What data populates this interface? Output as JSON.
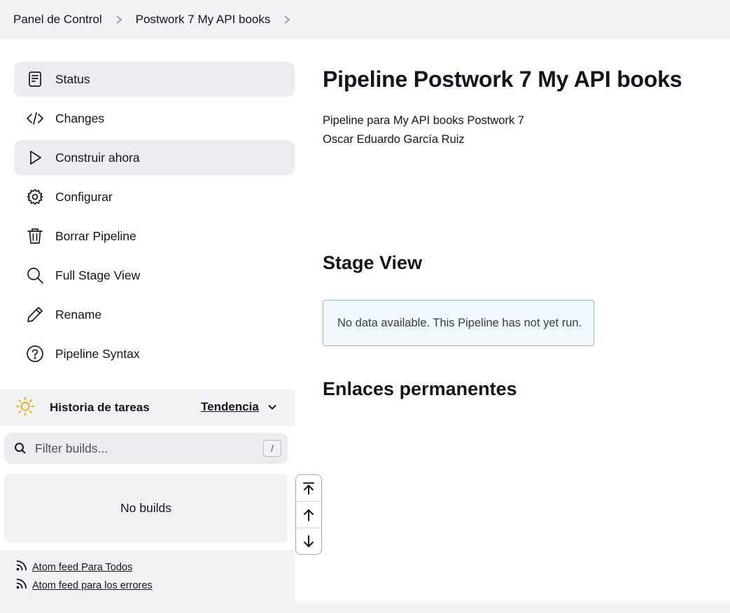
{
  "breadcrumb": {
    "items": [
      "Panel de Control",
      "Postwork 7 My API books"
    ]
  },
  "sidebar": {
    "items": [
      {
        "label": "Status",
        "icon": "document-icon",
        "highlighted": true
      },
      {
        "label": "Changes",
        "icon": "code-icon",
        "highlighted": false
      },
      {
        "label": "Construir ahora",
        "icon": "play-icon",
        "highlighted": true
      },
      {
        "label": "Configurar",
        "icon": "gear-icon",
        "highlighted": false
      },
      {
        "label": "Borrar Pipeline",
        "icon": "trash-icon",
        "highlighted": false
      },
      {
        "label": "Full Stage View",
        "icon": "search-icon",
        "highlighted": false
      },
      {
        "label": "Rename",
        "icon": "pencil-icon",
        "highlighted": false
      },
      {
        "label": "Pipeline Syntax",
        "icon": "help-icon",
        "highlighted": false
      }
    ]
  },
  "history": {
    "title": "Historia de tareas",
    "trend_label": "Tendencia",
    "filter_placeholder": "Filter builds...",
    "shortcut_key": "/",
    "empty_text": "No builds",
    "feeds": [
      "Atom feed Para Todos",
      "Atom feed para los errores"
    ],
    "sun_color": "#f2a900"
  },
  "main": {
    "title": "Pipeline Postwork 7 My API books",
    "description_lines": [
      "Pipeline para My API books Postwork 7",
      "Oscar Eduardo García Ruiz"
    ],
    "stage_view_heading": "Stage View",
    "stage_view_notice": "No data available. This Pipeline has not yet run.",
    "permalinks_heading": "Enlaces permanentes"
  },
  "colors": {
    "panel_bg": "#f2f2f5",
    "highlight_bg": "#ebebf0",
    "notice_bg": "#f0f7fd",
    "notice_border": "#9bb4cc"
  }
}
